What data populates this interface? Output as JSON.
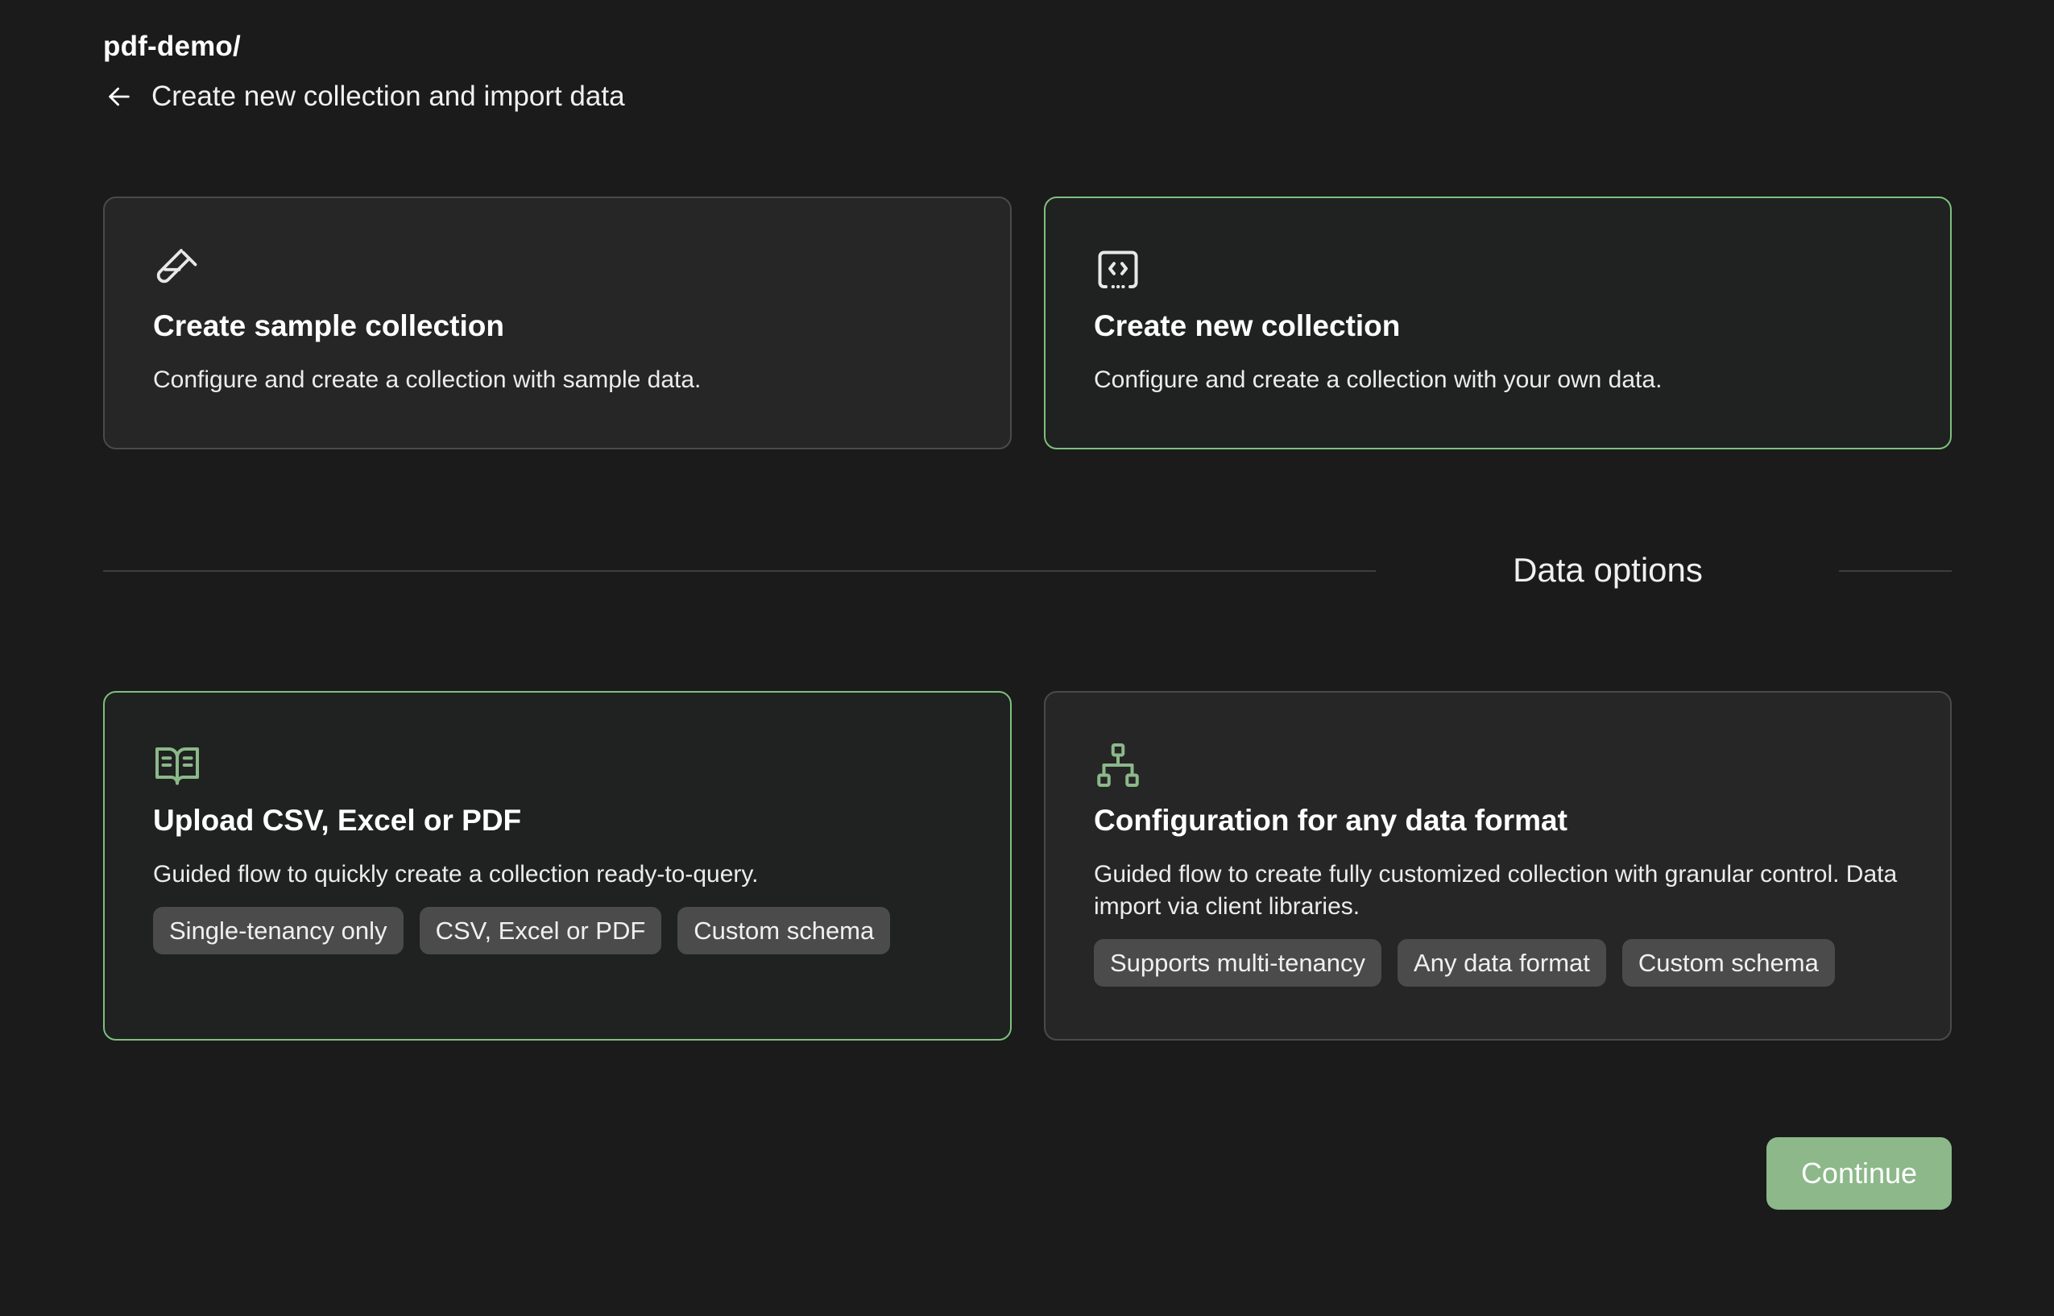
{
  "breadcrumb": "pdf-demo/",
  "header": {
    "title": "Create new collection and import data"
  },
  "collection_options": [
    {
      "icon": "test-tube-icon",
      "title": "Create sample collection",
      "description": "Configure and create a collection with sample data.",
      "selected": false
    },
    {
      "icon": "code-square-icon",
      "title": "Create new collection",
      "description": "Configure and create a collection with your own data.",
      "selected": true
    }
  ],
  "section_label": "Data options",
  "data_options": [
    {
      "icon": "open-book-icon",
      "title": "Upload CSV, Excel or PDF",
      "description": "Guided flow to quickly create a collection ready-to-query.",
      "tags": [
        "Single-tenancy only",
        "CSV, Excel or PDF",
        "Custom schema"
      ],
      "selected": true
    },
    {
      "icon": "hierarchy-icon",
      "title": "Configuration for any data format",
      "description": "Guided flow to create fully customized collection with granular control. Data import via client libraries.",
      "tags": [
        "Supports multi-tenancy",
        "Any data format",
        "Custom schema"
      ],
      "selected": false
    }
  ],
  "continue_label": "Continue",
  "colors": {
    "background": "#1b1b1b",
    "accent": "#7fbf7f",
    "button": "#8cb88a"
  }
}
